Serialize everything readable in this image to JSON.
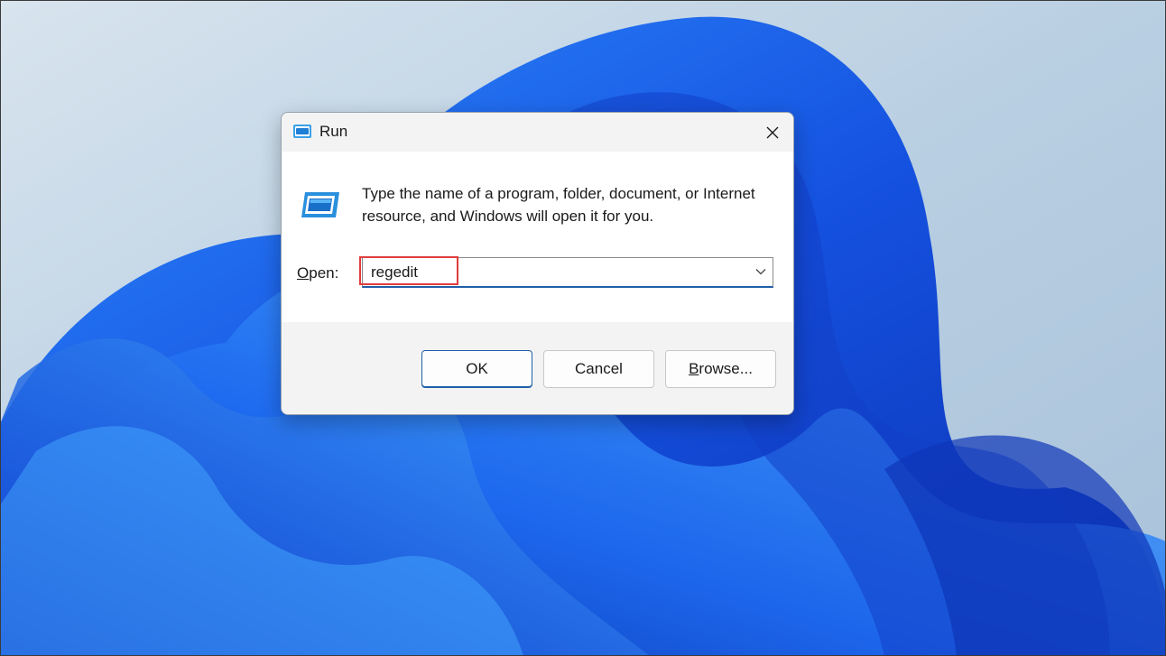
{
  "window": {
    "title": "Run",
    "close_icon": "close-icon",
    "app_icon": "run-icon"
  },
  "content": {
    "description": "Type the name of a program, folder, document, or Internet resource, and Windows will open it for you.",
    "open_label_mnemonic": "O",
    "open_label_rest": "pen:",
    "input_value": "regedit",
    "dropdown_icon": "chevron-down-icon"
  },
  "buttons": {
    "ok": "OK",
    "cancel": "Cancel",
    "browse_mnemonic": "B",
    "browse_rest": "rowse..."
  },
  "colors": {
    "accent": "#1f5fa8",
    "highlight": "#e03c3c",
    "wallpaper_bg": "#c9d8e6",
    "wallpaper_blue": "#1a5ce6"
  }
}
